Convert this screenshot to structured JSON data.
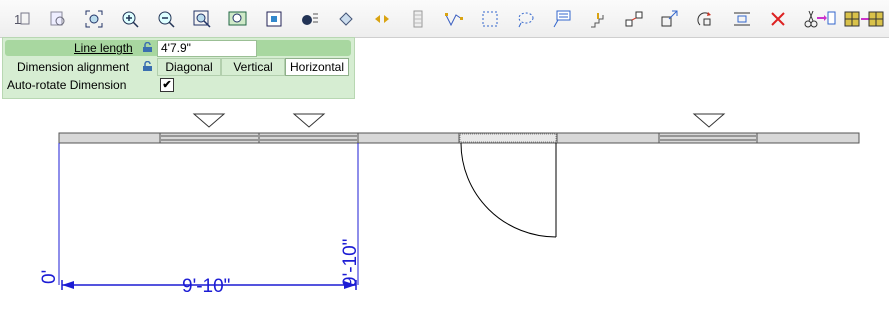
{
  "toolbar": {
    "buttons": [
      {
        "icon": "number-view-icon"
      },
      {
        "icon": "print-preview-icon"
      },
      {
        "icon": "zoom-extents-icon"
      },
      {
        "icon": "zoom-in-icon"
      },
      {
        "icon": "zoom-out-icon"
      },
      {
        "icon": "zoom-window-icon"
      },
      {
        "icon": "zoom-selection-icon"
      },
      {
        "icon": "fill-select-icon"
      },
      {
        "icon": "text-style-icon"
      },
      {
        "icon": "eraser-icon"
      },
      {
        "icon": "arrows-icon"
      },
      {
        "icon": "column-icon"
      },
      {
        "icon": "polyline-icon"
      },
      {
        "icon": "selection-box-icon"
      },
      {
        "icon": "lasso-icon"
      },
      {
        "icon": "label-icon"
      },
      {
        "icon": "stair-icon"
      },
      {
        "icon": "move-points-icon"
      },
      {
        "icon": "scale-icon"
      },
      {
        "icon": "rotate-icon"
      },
      {
        "icon": "align-icon"
      },
      {
        "icon": "delete-icon"
      },
      {
        "icon": "cut-paste-icon"
      },
      {
        "icon": "array-icon"
      }
    ]
  },
  "panel": {
    "line_length_label": "Line length",
    "line_length_value": "4'7.9\"",
    "dimension_alignment_label": "Dimension alignment",
    "alignment_options": [
      "Diagonal",
      "Vertical",
      "Horizontal"
    ],
    "selected_alignment": "Horizontal",
    "auto_rotate_label": "Auto-rotate Dimension",
    "auto_rotate_checked": "✔"
  },
  "drawing": {
    "dim_zero": "0'",
    "dim_horizontal": "9'-10\"",
    "dim_vertical": "9'-10\"",
    "dim_color": "#1c1cd4"
  }
}
